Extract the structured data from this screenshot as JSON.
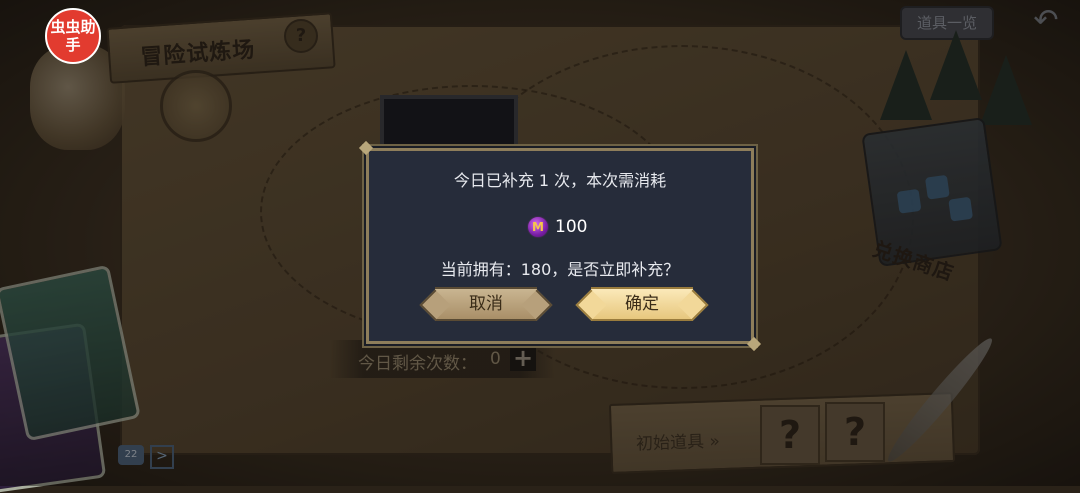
{
  "app_badge": "虫虫助手",
  "header": {
    "title": "冒险试炼场",
    "help_icon": "?",
    "items_button": "道具一览",
    "back_icon": "↶"
  },
  "shop": {
    "label": "兑换商店"
  },
  "remaining": {
    "label": "今日剩余次数：",
    "count": "0",
    "plus": "+"
  },
  "initial_items": {
    "label": "初始道具 »",
    "slots": [
      "?",
      "?"
    ]
  },
  "chat": {
    "icon_text": "22",
    "arrow": ">"
  },
  "dialog": {
    "line1": "今日已补充 1 次，本次需消耗",
    "currency_icon": "M",
    "cost": "100",
    "line2": "当前拥有：180，是否立即补充？",
    "cancel_label": "取消",
    "confirm_label": "确定"
  },
  "colors": {
    "dialog_bg": "#262c3a",
    "dialog_border": "#8e7e5b",
    "confirm_button": "#f2d899",
    "cancel_button": "#b7a07b",
    "badge": "#e23b2f"
  }
}
